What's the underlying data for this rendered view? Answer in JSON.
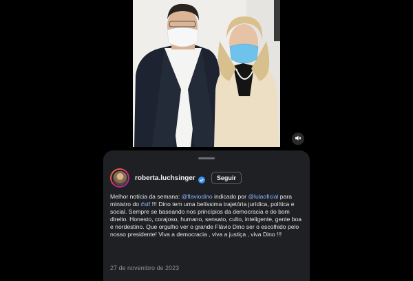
{
  "post": {
    "username": "roberta.luchsinger",
    "follow_label": "Seguir",
    "date": "27 de novembro de 2023",
    "caption": {
      "t1": "Melhor notícia da semana: ",
      "mention1": "@flaviodino",
      "t2": " indicado por ",
      "mention2": "@lulaoficial",
      "t3": " para ministro do ",
      "hashtag": "#stf",
      "t4": " !!! Dino tem uma belíssima trajetória jurídica, política e social. Sempre se baseando nos princípios da democracia e do bom direito. Honesto, corajoso, humano, sensato, culto, inteligente, gente boa e nordestino. Que orgulho ver o grande Flávio Dino ser o escolhido pelo nosso presidente! Viva a democracia , viva a justiça , viva Dino !!!"
    }
  },
  "icons": {
    "mute": "speaker-muted-icon",
    "verified": "verified-badge-icon"
  },
  "colors": {
    "background": "#000000",
    "panel": "#1f2024",
    "link": "#8fb4ff",
    "text": "#e8e8e8",
    "muted_text": "#8d8f94",
    "verified": "#3897f0"
  }
}
